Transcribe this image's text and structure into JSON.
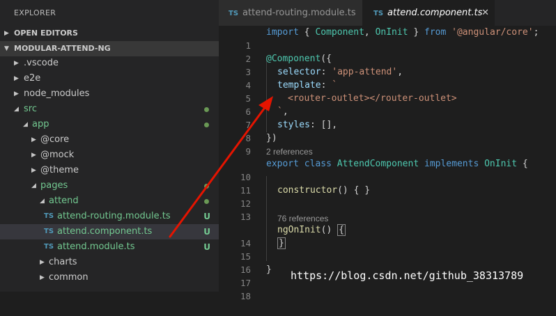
{
  "sidebar": {
    "title": "EXPLORER",
    "open_editors": "OPEN EDITORS",
    "project": "MODULAR-ATTEND-NG",
    "items": [
      {
        "label": "vscode_label",
        "text": ".vscode"
      },
      {
        "label": "e2e",
        "text": "e2e"
      },
      {
        "label": "node_modules",
        "text": "node_modules"
      },
      {
        "label": "src",
        "text": "src"
      },
      {
        "label": "app",
        "text": "app"
      },
      {
        "label": "@core",
        "text": "@core"
      },
      {
        "label": "@mock",
        "text": "@mock"
      },
      {
        "label": "@theme",
        "text": "@theme"
      },
      {
        "label": "pages",
        "text": "pages"
      },
      {
        "label": "attend",
        "text": "attend"
      },
      {
        "label": "attend-routing",
        "text": "attend-routing.module.ts"
      },
      {
        "label": "attend-component",
        "text": "attend.component.ts"
      },
      {
        "label": "attend-module",
        "text": "attend.module.ts"
      },
      {
        "label": "charts",
        "text": "charts"
      },
      {
        "label": "common",
        "text": "common"
      }
    ],
    "ts_badge": "TS",
    "untracked_badge": "U"
  },
  "tabs": [
    {
      "badge": "TS",
      "name": "attend-routing.module.ts"
    },
    {
      "badge": "TS",
      "name": "attend.component.ts",
      "close": "✕"
    }
  ],
  "editor": {
    "line_numbers": [
      "1",
      "2",
      "3",
      "4",
      "5",
      "6",
      "7",
      "8",
      "9",
      "10",
      "11",
      "12",
      "13",
      "14",
      "15",
      "16",
      "17",
      "18"
    ],
    "code": {
      "l1_import": "import",
      "l1_open": " { ",
      "l1_component": "Component",
      "l1_comma": ", ",
      "l1_oninit": "OnInit",
      "l1_close": " } ",
      "l1_from": "from",
      "l1_sp": " ",
      "l1_module": "'@angular/core'",
      "l1_semi": ";",
      "l3_decorator": "@Component",
      "l3_open": "({",
      "l4_selector": "selector",
      "l4_colon": ": ",
      "l4_value": "'app-attend'",
      "l4_comma": ",",
      "l5_template": "template",
      "l5_colon": ": ",
      "l5_tick": "`",
      "l6_tpl": "<router-outlet></router-outlet>",
      "l7_tick": "`",
      "l7_comma": ",",
      "l8_styles": "styles",
      "l8_rest": ": [],",
      "l9_close": "})",
      "l10_export": "export",
      "l10_class": "class",
      "l10_name": "AttendComponent",
      "l10_implements": "implements",
      "l10_oninit": "OnInit",
      "l10_brace": " {",
      "l12_constructor": "constructor",
      "l12_rest": "() { }",
      "l14_method": "ngOnInit",
      "l14_paren": "() ",
      "l14_brace": "{",
      "l15_brace": "}",
      "l17_brace": "}"
    },
    "lens_2_references": "2 references",
    "lens_76_references": "76 references"
  },
  "watermark": "https://blog.csdn.net/github_38313789",
  "colors": {
    "keyword": "#569cd6",
    "type": "#4ec9b0",
    "string": "#ce9178",
    "property": "#9cdcfe",
    "function": "#dcdcaa",
    "annotation_arrow": "#e51400",
    "git_untracked": "#73c991"
  }
}
